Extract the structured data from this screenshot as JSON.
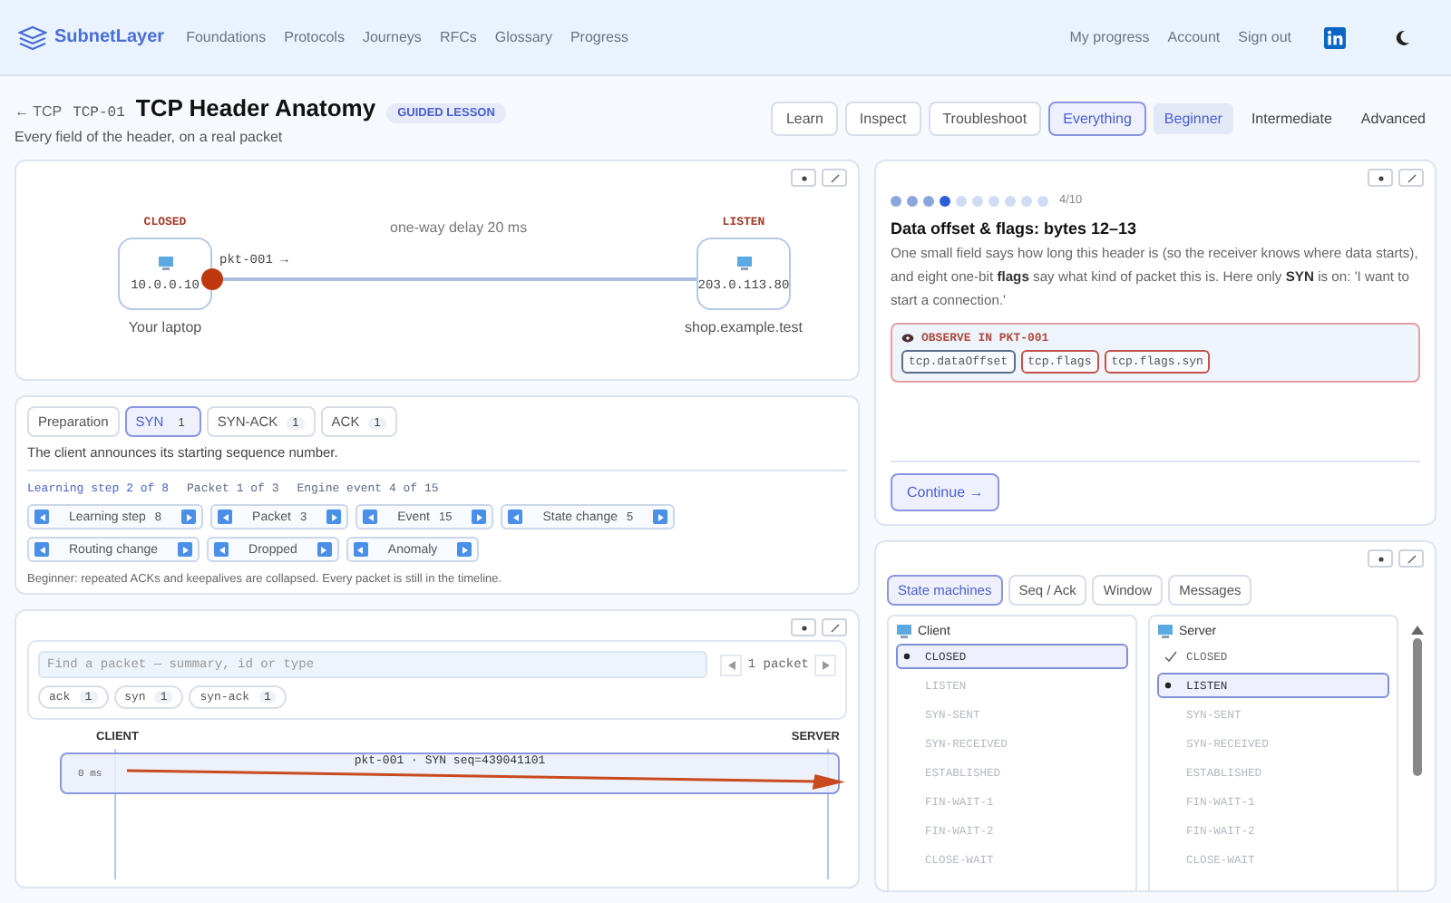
{
  "nav": {
    "brand": "SubnetLayer",
    "links": [
      "Foundations",
      "Protocols",
      "Journeys",
      "RFCs",
      "Glossary",
      "Progress"
    ],
    "account_links": [
      "My progress",
      "Account",
      "Sign out"
    ]
  },
  "lesson_header": {
    "back": "← TCP",
    "code": "TCP-01",
    "title": "TCP Header Anatomy",
    "badge": "GUIDED LESSON",
    "subtitle": "Every field of the header, on a real packet"
  },
  "modes": [
    {
      "label": "Learn",
      "selected": false
    },
    {
      "label": "Inspect",
      "selected": false
    },
    {
      "label": "Troubleshoot",
      "selected": false
    },
    {
      "label": "Everything",
      "selected": true
    }
  ],
  "levels": [
    {
      "label": "Beginner",
      "selected": true
    },
    {
      "label": "Intermediate",
      "selected": false
    },
    {
      "label": "Advanced",
      "selected": false
    }
  ],
  "topology": {
    "delay": "one-way delay 20 ms",
    "packet_label": "pkt-001 →",
    "nodes": [
      {
        "state": "CLOSED",
        "address": "10.0.0.10",
        "name": "Your laptop"
      },
      {
        "state": "LISTEN",
        "address": "203.0.113.80",
        "name": "shop.example.test"
      }
    ]
  },
  "phases": [
    {
      "label": "Preparation",
      "selected": false
    },
    {
      "label": "SYN",
      "count": "1",
      "selected": true
    },
    {
      "label": "SYN-ACK",
      "count": "1",
      "selected": false
    },
    {
      "label": "ACK",
      "count": "1",
      "selected": false
    }
  ],
  "phase_description": "The client announces its starting sequence number.",
  "position": [
    "Learning step 2 of 8",
    "Packet 1 of 3",
    "Engine event 4 of 15"
  ],
  "steppers": [
    {
      "label": "Learning step",
      "count": "8"
    },
    {
      "label": "Packet",
      "count": "3"
    },
    {
      "label": "Event",
      "count": "15"
    },
    {
      "label": "State change",
      "count": "5"
    },
    {
      "label": "Routing change"
    },
    {
      "label": "Dropped"
    },
    {
      "label": "Anomaly"
    }
  ],
  "note": "Beginner: repeated ACKs and keepalives are collapsed. Every packet is still in the timeline.",
  "lesson_card": {
    "progress_label": "4/10",
    "dots": [
      {
        "done": true,
        "selected": false
      },
      {
        "done": true,
        "selected": false
      },
      {
        "done": true,
        "selected": false
      },
      {
        "done": false,
        "selected": true
      },
      {
        "done": false,
        "selected": false
      },
      {
        "done": false,
        "selected": false
      },
      {
        "done": false,
        "selected": false
      },
      {
        "done": false,
        "selected": false
      },
      {
        "done": false,
        "selected": false
      },
      {
        "done": false,
        "selected": false
      }
    ],
    "heading": "Data offset & flags: bytes 12–13",
    "body": "One small field says how long this header is (so the receiver knows where data starts), and eight one-bit **flags** say what kind of packet this is. Here only **SYN** is on: 'I want to start a connection.'",
    "observe_title": "OBSERVE IN PKT-001",
    "fields": [
      {
        "label": "tcp.dataOffset",
        "color": "#5a6d8a"
      },
      {
        "label": "tcp.flags",
        "color": "#c0524a"
      },
      {
        "label": "tcp.flags.syn",
        "color": "#c0524a"
      }
    ],
    "continue": "Continue →"
  },
  "timeline": {
    "search_placeholder": "Find a packet — summary, id or type",
    "packet_count": "1 packet",
    "filters": [
      {
        "label": "ack",
        "count": "1"
      },
      {
        "label": "syn",
        "count": "1"
      },
      {
        "label": "syn-ack",
        "count": "1"
      }
    ],
    "lanes": [
      "CLIENT",
      "SERVER"
    ],
    "rows": [
      {
        "time": "0 ms",
        "summary": "pkt-001 · SYN seq=439041101"
      }
    ]
  },
  "state_panel": {
    "tabs": [
      {
        "label": "State machines",
        "selected": true
      },
      {
        "label": "Seq / Ack",
        "selected": false
      },
      {
        "label": "Window",
        "selected": false
      },
      {
        "label": "Messages",
        "selected": false
      }
    ],
    "machines": [
      {
        "title": "Client",
        "states": [
          {
            "label": "CLOSED",
            "selected": true,
            "visited": false
          },
          {
            "label": "LISTEN",
            "selected": false,
            "visited": false
          },
          {
            "label": "SYN-SENT",
            "selected": false,
            "visited": false
          },
          {
            "label": "SYN-RECEIVED",
            "selected": false,
            "visited": false
          },
          {
            "label": "ESTABLISHED",
            "selected": false,
            "visited": false
          },
          {
            "label": "FIN-WAIT-1",
            "selected": false,
            "visited": false
          },
          {
            "label": "FIN-WAIT-2",
            "selected": false,
            "visited": false
          },
          {
            "label": "CLOSE-WAIT",
            "selected": false,
            "visited": false
          }
        ]
      },
      {
        "title": "Server",
        "states": [
          {
            "label": "CLOSED",
            "selected": false,
            "visited": true
          },
          {
            "label": "LISTEN",
            "selected": true,
            "visited": false
          },
          {
            "label": "SYN-SENT",
            "selected": false,
            "visited": false
          },
          {
            "label": "SYN-RECEIVED",
            "selected": false,
            "visited": false
          },
          {
            "label": "ESTABLISHED",
            "selected": false,
            "visited": false
          },
          {
            "label": "FIN-WAIT-1",
            "selected": false,
            "visited": false
          },
          {
            "label": "FIN-WAIT-2",
            "selected": false,
            "visited": false
          },
          {
            "label": "CLOSE-WAIT",
            "selected": false,
            "visited": false
          }
        ]
      }
    ]
  }
}
